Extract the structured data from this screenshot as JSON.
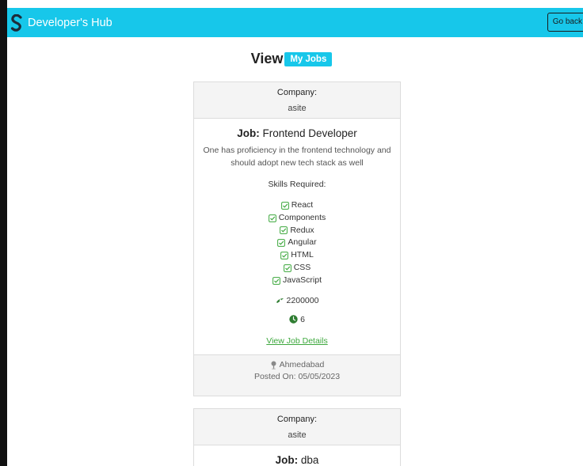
{
  "navbar": {
    "brand_text": "Developer's Hub",
    "go_back_label": "Go back",
    "bg_color": "#17c7ea"
  },
  "page": {
    "heading": "View",
    "badge": "My Jobs"
  },
  "jobs": [
    {
      "company_label": "Company:",
      "company": "asite",
      "job_label": "Job:",
      "job_title": "Frontend Developer",
      "description": "One has proficiency in the frontend technology and should adopt new tech stack as well",
      "skills_title": "Skills Required:",
      "skills": [
        "React",
        "Components",
        "Redux",
        "Angular",
        "HTML",
        "CSS",
        "JavaScript"
      ],
      "salary": "2200000",
      "experience": "6",
      "details_link": "View Job Details",
      "location": "Ahmedabad",
      "posted_label": "Posted On:",
      "posted_date": "05/05/2023"
    },
    {
      "company_label": "Company:",
      "company": "asite",
      "job_label": "Job:",
      "job_title": "dba"
    }
  ],
  "icons": {
    "brand": "brand-logo-icon",
    "skill": "check-square-icon",
    "salary": "money-icon",
    "experience": "clock-icon",
    "location": "map-pin-icon"
  },
  "colors": {
    "accent": "#17c7ea",
    "success": "#3da83d",
    "icon_green": "#2f7d32"
  }
}
